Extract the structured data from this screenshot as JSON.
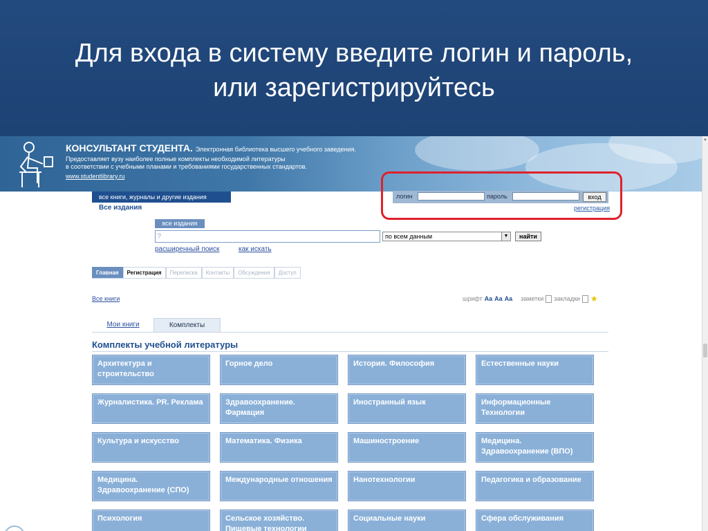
{
  "slide": {
    "title_line1": "Для входа в систему введите логин и пароль,",
    "title_line2": "или зарегистрируйтесь"
  },
  "site": {
    "name": "КОНСУЛЬТАНТ СТУДЕНТА.",
    "tagline": "Электронная библиотека высшего учебного заведения.",
    "desc_line1": "Предоставляет вузу наиболее полные комплекты необходимой литературы",
    "desc_line2": "в соответствии с учебными планами и требованиями государственных стандартов.",
    "url": "www.studentlibrary.ru"
  },
  "login": {
    "login_label": "логин",
    "password_label": "пароль",
    "submit_label": "вход",
    "register_link": "регистрация"
  },
  "scope": {
    "tab_label": "все книги, журналы и другие издания",
    "sub_label": "Все издания"
  },
  "search": {
    "scope_tag": "все издания",
    "input_value": "?",
    "select_value": "по всем данным",
    "find_label": "найти",
    "advanced_link": "расширенный поиск",
    "howto_link": "как искать"
  },
  "nav": {
    "tabs": [
      "Главная",
      "Регистрация",
      "Переписка",
      "Контакты",
      "Обсуждения",
      "Доступ"
    ]
  },
  "toolbar": {
    "all_books": "Все книги",
    "font_label": "шрифт",
    "aa_plus": "Aa",
    "aa_mid": "Aa",
    "aa_minus": "Aa",
    "notes_label": "заметки",
    "bookmarks_label": "закладки"
  },
  "book_tabs": {
    "my_books": "Мои книги",
    "sets": "Комплекты"
  },
  "section": {
    "title": "Комплекты учебной литературы"
  },
  "categories": [
    "Архитектура и строительство",
    "Горное дело",
    "История. Философия",
    "Естественные науки",
    "Журналистика. PR. Реклама",
    "Здравоохранение. Фармация",
    "Иностранный язык",
    "Информационные Технологии",
    "Культура и искусство",
    "Математика. Физика",
    "Машиностроение",
    "Медицина. Здравоохранение (ВПО)",
    "Медицина. Здравоохранение (СПО)",
    "Международные отношения",
    "Нанотехнологии",
    "Педагогика и образование",
    "Психология",
    "Сельское хозяйство. Пищевые технологии",
    "Социальные науки",
    "Сфера обслуживания"
  ],
  "colors": {
    "slide_bg": "#1f4677",
    "accent": "#1f4f8f",
    "category_bg": "#8ab0d8",
    "highlight": "#e0202a"
  }
}
